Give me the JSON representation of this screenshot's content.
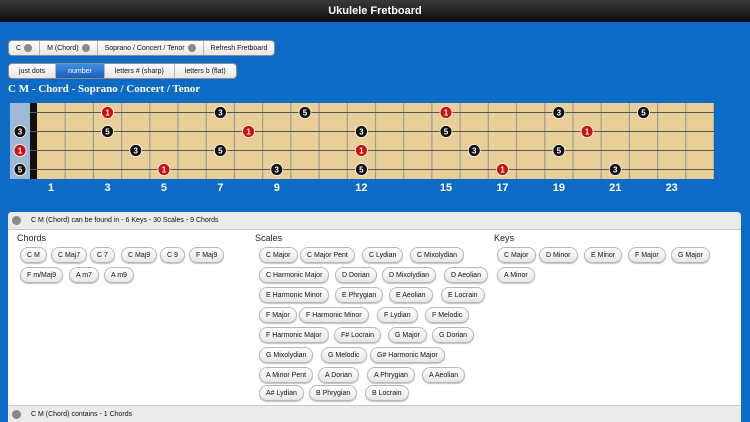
{
  "app": {
    "title": "Ukulele Fretboard"
  },
  "selectors": [
    {
      "label": "C"
    },
    {
      "label": "M (Chord)"
    },
    {
      "label": "Soprano / Concert / Tenor"
    },
    {
      "label": "Refresh Fretboard"
    }
  ],
  "display_modes": [
    {
      "label": "just dots",
      "active": false
    },
    {
      "label": "number",
      "active": true
    },
    {
      "label": "letters # (sharp)",
      "active": false
    },
    {
      "label": "letters b (flat)",
      "active": false
    }
  ],
  "subtitle": "C M - Chord - Soprano / Concert / Tenor",
  "fretboard": {
    "fret_count": 24,
    "fret_numbers": [
      "1",
      "3",
      "5",
      "7",
      "9",
      "12",
      "15",
      "17",
      "19",
      "21",
      "23"
    ],
    "open_strings": [
      "",
      "3",
      "1",
      "5"
    ],
    "notes": [
      {
        "string": 1,
        "fret": 3,
        "label": "1",
        "root": true
      },
      {
        "string": 1,
        "fret": 7,
        "label": "3",
        "root": false
      },
      {
        "string": 1,
        "fret": 10,
        "label": "5",
        "root": false
      },
      {
        "string": 1,
        "fret": 15,
        "label": "1",
        "root": true
      },
      {
        "string": 1,
        "fret": 19,
        "label": "3",
        "root": false
      },
      {
        "string": 1,
        "fret": 22,
        "label": "5",
        "root": false
      },
      {
        "string": 2,
        "fret": 3,
        "label": "5",
        "root": false
      },
      {
        "string": 2,
        "fret": 8,
        "label": "1",
        "root": true
      },
      {
        "string": 2,
        "fret": 12,
        "label": "3",
        "root": false
      },
      {
        "string": 2,
        "fret": 15,
        "label": "5",
        "root": false
      },
      {
        "string": 2,
        "fret": 20,
        "label": "1",
        "root": true
      },
      {
        "string": 3,
        "fret": 4,
        "label": "3",
        "root": false
      },
      {
        "string": 3,
        "fret": 7,
        "label": "5",
        "root": false
      },
      {
        "string": 3,
        "fret": 12,
        "label": "1",
        "root": true
      },
      {
        "string": 3,
        "fret": 16,
        "label": "3",
        "root": false
      },
      {
        "string": 3,
        "fret": 19,
        "label": "5",
        "root": false
      },
      {
        "string": 4,
        "fret": 5,
        "label": "1",
        "root": true
      },
      {
        "string": 4,
        "fret": 9,
        "label": "3",
        "root": false
      },
      {
        "string": 4,
        "fret": 12,
        "label": "5",
        "root": false
      },
      {
        "string": 4,
        "fret": 17,
        "label": "1",
        "root": true
      },
      {
        "string": 4,
        "fret": 21,
        "label": "3",
        "root": false
      }
    ],
    "colors": {
      "wood": "#e8cf98",
      "root_dot": "#cc1010",
      "note_dot": "#111111",
      "nut": "#111111"
    }
  },
  "found_in": {
    "header": "C M (Chord) can be found in - 6 Keys - 30 Scales - 9 Chords",
    "chords_heading": "Chords",
    "scales_heading": "Scales",
    "keys_heading": "Keys",
    "chords": [
      "C M",
      "C Maj7",
      "C 7",
      "C Maj9",
      "C 9",
      "F Maj9",
      "F m/Maj9",
      "A m7",
      "A m9"
    ],
    "scales": [
      "C Major",
      "C Major Pent",
      "C Lydian",
      "C Mixolydian",
      "C Harmonic Major",
      "D Dorian",
      "D Mixolydian",
      "D Aeolian",
      "E Harmonic Minor",
      "E Phrygian",
      "E Aeolian",
      "E Locrain",
      "F Major",
      "F Harmonic Minor",
      "F Lydian",
      "F Melodic",
      "F Harmonic Major",
      "F# Locrain",
      "G Major",
      "G Dorian",
      "G Mixolydian",
      "G Melodic",
      "G# Harmonic Major",
      "A Minor Pent",
      "A Dorian",
      "A Phrygian",
      "A Aeolian",
      "A# Lydian",
      "B Phrygian",
      "B Locrain"
    ],
    "keys": [
      "C Major",
      "D Minor",
      "E Minor",
      "F Major",
      "G Major",
      "A Minor"
    ]
  },
  "contains": {
    "header": "C M (Chord) contains - 1 Chords"
  }
}
